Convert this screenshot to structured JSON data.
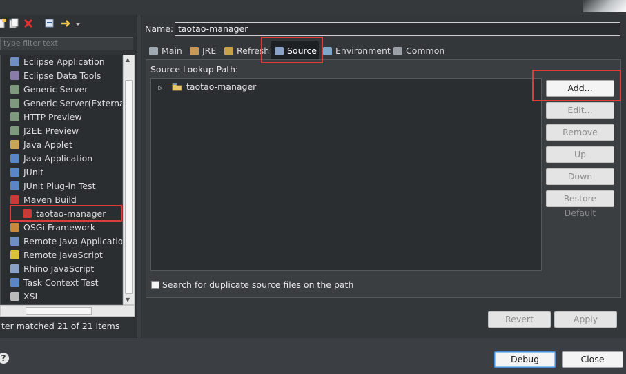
{
  "toolbar": {
    "icons": [
      "new-config-icon",
      "duplicate-icon",
      "delete-icon",
      "collapse-icon",
      "filter-icon"
    ]
  },
  "filter": {
    "placeholder": "type filter text"
  },
  "tree": {
    "items": [
      {
        "label": "Eclipse Application",
        "icon": "eclipse-app-icon",
        "color": "#6f8ec6"
      },
      {
        "label": "Eclipse Data Tools",
        "icon": "data-tools-icon",
        "color": "#8a7ca8"
      },
      {
        "label": "Generic Server",
        "icon": "server-icon",
        "color": "#7e9a7e"
      },
      {
        "label": "Generic Server(External L",
        "icon": "server-icon",
        "color": "#7e9a7e"
      },
      {
        "label": "HTTP Preview",
        "icon": "server-icon",
        "color": "#7e9a7e"
      },
      {
        "label": "J2EE Preview",
        "icon": "server-icon",
        "color": "#7e9a7e"
      },
      {
        "label": "Java Applet",
        "icon": "applet-icon",
        "color": "#c8a557"
      },
      {
        "label": "Java Application",
        "icon": "java-app-icon",
        "color": "#5a86c8"
      },
      {
        "label": "JUnit",
        "icon": "junit-icon",
        "color": "#5a86c8"
      },
      {
        "label": "JUnit Plug-in Test",
        "icon": "junit-plugin-icon",
        "color": "#5a86c8"
      },
      {
        "label": "Maven Build",
        "icon": "maven-icon",
        "color": "#c83a3a"
      },
      {
        "label": "taotao-manager",
        "icon": "maven-icon",
        "color": "#c83a3a",
        "child": true
      },
      {
        "label": "OSGi Framework",
        "icon": "osgi-icon",
        "color": "#c88a3a"
      },
      {
        "label": "Remote Java Application",
        "icon": "remote-java-icon",
        "color": "#6f8ec6"
      },
      {
        "label": "Remote JavaScript",
        "icon": "remote-js-icon",
        "color": "#d8c23a"
      },
      {
        "label": "Rhino JavaScript",
        "icon": "rhino-icon",
        "color": "#8aa2c8"
      },
      {
        "label": "Task Context Test",
        "icon": "task-test-icon",
        "color": "#5a86c8"
      },
      {
        "label": "XSL",
        "icon": "xsl-icon",
        "color": "#bbbbbb"
      }
    ]
  },
  "status": {
    "text": "ter matched 21 of 21 items"
  },
  "name": {
    "label": "Name:",
    "value": "taotao-manager"
  },
  "tabs": [
    {
      "label": "Main",
      "icon": "main-tab-icon"
    },
    {
      "label": "JRE",
      "icon": "jre-icon"
    },
    {
      "label": "Refresh",
      "icon": "refresh-icon"
    },
    {
      "label": "Source",
      "icon": "source-icon",
      "selected": true
    },
    {
      "label": "Environment",
      "icon": "environment-icon"
    },
    {
      "label": "Common",
      "icon": "common-icon"
    }
  ],
  "source": {
    "lookup_label": "Source Lookup Path:",
    "entries": [
      {
        "label": "taotao-manager",
        "icon": "project-folder-icon"
      }
    ],
    "buttons": {
      "add": "Add...",
      "edit": "Edit...",
      "remove": "Remove",
      "up": "Up",
      "down": "Down",
      "restore": "Restore Default"
    },
    "duplicate_checkbox": {
      "label": "Search for duplicate source files on the path",
      "checked": false
    }
  },
  "footer": {
    "revert": "Revert",
    "apply": "Apply",
    "debug": "Debug",
    "close": "Close",
    "help": "?"
  },
  "colors": {
    "highlight": "#e03b3b",
    "background": "#3b3f43"
  }
}
